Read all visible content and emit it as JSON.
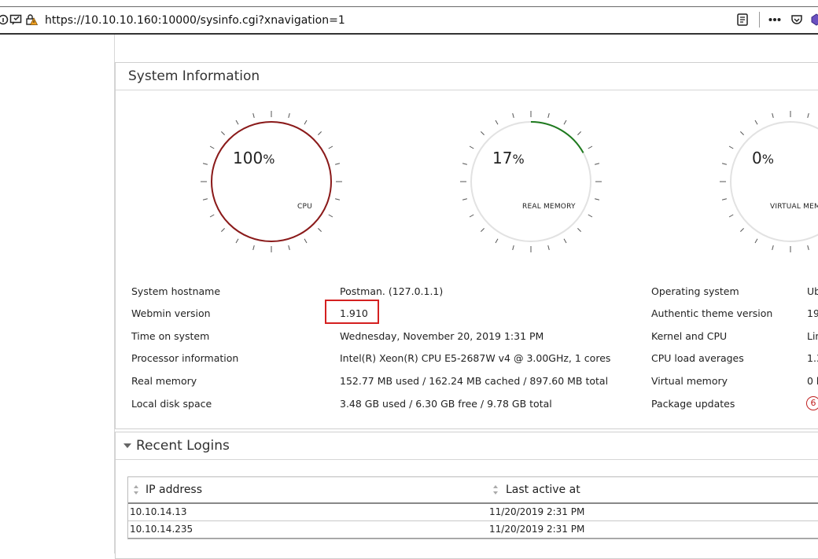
{
  "browser": {
    "url": "https://10.10.10.160:10000/sysinfo.cgi?xnavigation=1"
  },
  "sysinfo": {
    "title": "System Information",
    "gauges": [
      {
        "value": "100",
        "unit": "%",
        "label": "CPU",
        "fraction": 1.0,
        "color": "#8b1a1a"
      },
      {
        "value": "17",
        "unit": "%",
        "label": "REAL MEMORY",
        "fraction": 0.17,
        "color": "#1e7a1e"
      },
      {
        "value": "0",
        "unit": "%",
        "label": "VIRTUAL MEM",
        "fraction": 0.0,
        "color": "#1e7a1e"
      }
    ],
    "left_info": [
      {
        "label": "System hostname",
        "value": "Postman. (127.0.1.1)"
      },
      {
        "label": "Webmin version",
        "value": "1.910"
      },
      {
        "label": "Time on system",
        "value": "Wednesday, November 20, 2019 1:31 PM"
      },
      {
        "label": "Processor information",
        "value": "Intel(R) Xeon(R) CPU E5-2687W v4 @ 3.00GHz, 1 cores"
      },
      {
        "label": "Real memory",
        "value": "152.77 MB used / 162.24 MB cached / 897.60 MB total"
      },
      {
        "label": "Local disk space",
        "value": "3.48 GB used / 6.30 GB free / 9.78 GB total"
      }
    ],
    "right_info": [
      {
        "label": "Operating system",
        "value": "Ub"
      },
      {
        "label": "Authentic theme version",
        "value": "19"
      },
      {
        "label": "Kernel and CPU",
        "value": "Lin"
      },
      {
        "label": "CPU load averages",
        "value": "1.3"
      },
      {
        "label": "Virtual memory",
        "value": "0 b"
      },
      {
        "label": "Package updates",
        "value": "6"
      }
    ]
  },
  "logins": {
    "title": "Recent Logins",
    "columns": [
      "IP address",
      "Last active at"
    ],
    "rows": [
      [
        "10.10.14.13",
        "11/20/2019 2:31 PM"
      ],
      [
        "10.10.14.235",
        "11/20/2019 2:31 PM"
      ]
    ]
  },
  "colors": {
    "cpu_arc": "#8b1a1a",
    "mem_arc": "#1e7a1e",
    "highlight": "#d42020",
    "package_badge": "#c02020"
  }
}
